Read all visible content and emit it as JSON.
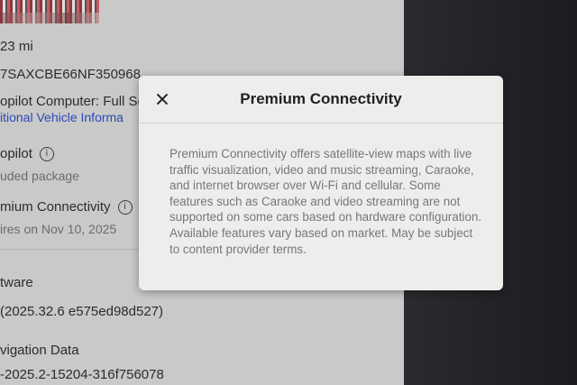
{
  "background": {
    "rows": [
      {
        "text": "23 mi"
      },
      {
        "text": "7SAXCBE66NF350968"
      },
      {
        "text": "opilot Computer: Full Se"
      },
      {
        "text": "itional Vehicle Informa"
      },
      {
        "text": "opilot"
      },
      {
        "text": "uded package"
      },
      {
        "text": "mium Connectivity"
      },
      {
        "text": "ires on Nov 10, 2025"
      },
      {
        "text": "tware"
      },
      {
        "text": "(2025.32.6 e575ed98d527)"
      },
      {
        "text": "vigation Data"
      },
      {
        "text": "-2025.2-15204-316f756078"
      }
    ],
    "info_glyph": "i"
  },
  "modal": {
    "title": "Premium Connectivity",
    "body": "Premium Connectivity offers satellite-view maps with live traffic visualization, video and music streaming, Caraoke, and internet browser over Wi-Fi and cellular. Some features such as Caraoke and video streaming are not supported on some cars based on hardware configuration. Available features vary based on market. May be subject to content provider terms."
  },
  "colors": {
    "link": "#2c49b8",
    "modal_bg": "#eeedec",
    "screen_bg": "#c9c9c8"
  },
  "icons": {
    "close": "close-icon",
    "info": "info-icon"
  }
}
